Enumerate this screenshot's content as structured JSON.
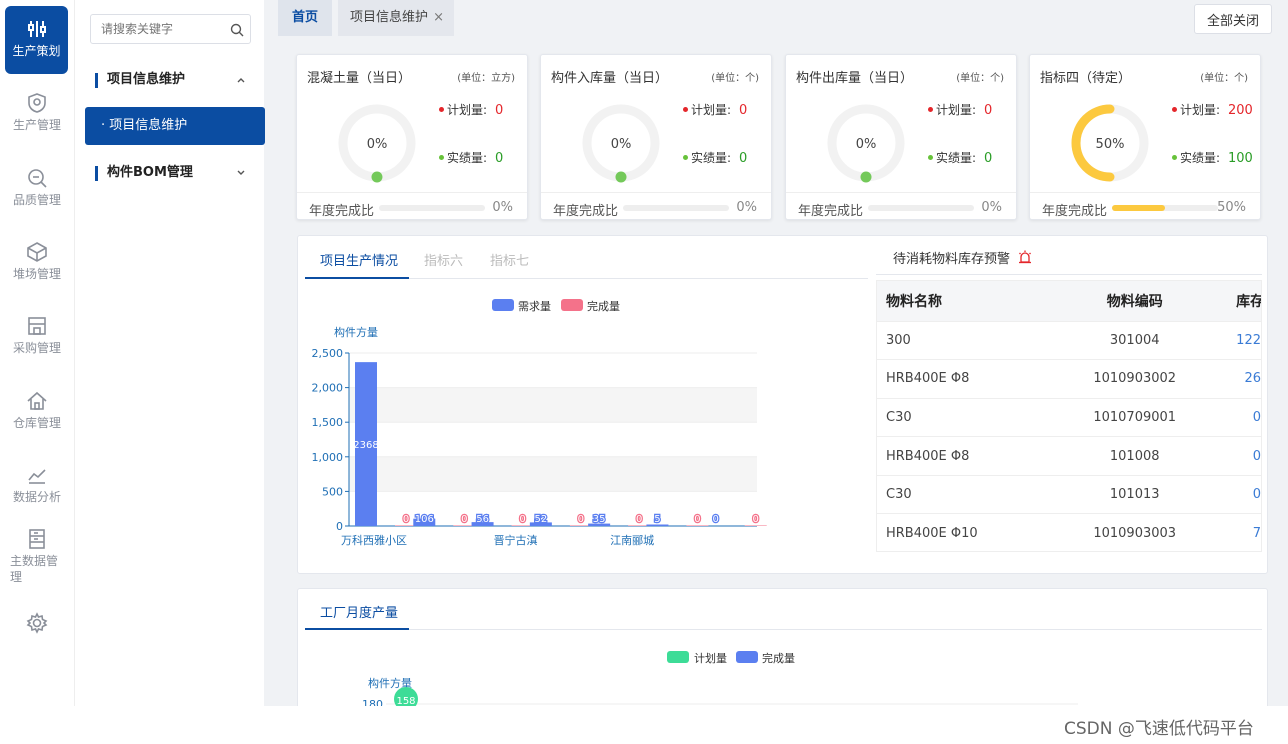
{
  "sidebar": {
    "items": [
      {
        "label": "生产策划",
        "icon": "sliders-icon"
      },
      {
        "label": "生产管理",
        "icon": "shield-icon"
      },
      {
        "label": "品质管理",
        "icon": "magnifier-icon"
      },
      {
        "label": "堆场管理",
        "icon": "cube-icon"
      },
      {
        "label": "采购管理",
        "icon": "store-icon"
      },
      {
        "label": "仓库管理",
        "icon": "house-icon"
      },
      {
        "label": "数据分析",
        "icon": "trend-icon"
      },
      {
        "label": "主数据管理",
        "icon": "server-icon"
      },
      {
        "label": "",
        "icon": "gear-icon"
      }
    ]
  },
  "menu": {
    "search_placeholder": "请搜索关键字",
    "group1": "项目信息维护",
    "sub1": "项目信息维护",
    "group2": "构件BOM管理"
  },
  "tabs": {
    "home": "首页",
    "current": "项目信息维护",
    "close": "×",
    "close_all": "全部关闭"
  },
  "cards": [
    {
      "title": "混凝土量（当日）",
      "unit": "(单位：立方)",
      "pct_label": "0%",
      "pct": 0,
      "plan_label": "计划量:",
      "plan": "0",
      "actual_label": "实绩量:",
      "actual": "0",
      "year_label": "年度完成比",
      "year_pct_label": "0%",
      "year_pct": 0
    },
    {
      "title": "构件入库量（当日）",
      "unit": "(单位：个)",
      "pct_label": "0%",
      "pct": 0,
      "plan_label": "计划量:",
      "plan": "0",
      "actual_label": "实绩量:",
      "actual": "0",
      "year_label": "年度完成比",
      "year_pct_label": "0%",
      "year_pct": 0
    },
    {
      "title": "构件出库量（当日）",
      "unit": "(单位：个)",
      "pct_label": "0%",
      "pct": 0,
      "plan_label": "计划量:",
      "plan": "0",
      "actual_label": "实绩量:",
      "actual": "0",
      "year_label": "年度完成比",
      "year_pct_label": "0%",
      "year_pct": 0
    },
    {
      "title": "指标四（待定）",
      "unit": "(单位：个)",
      "pct_label": "50%",
      "pct": 50,
      "plan_label": "计划量:",
      "plan": "200",
      "actual_label": "实绩量:",
      "actual": "100",
      "year_label": "年度完成比",
      "year_pct_label": "50%",
      "year_pct": 50
    }
  ],
  "colors": {
    "brand": "#0b4da2",
    "plan_dot": "#e4262b",
    "actual_dot": "#67c23a",
    "gauge": "#fcc93f",
    "demand": "#5b7ff0",
    "done": "#f4728a",
    "plan_green": "#3ddc97"
  },
  "production": {
    "tabs": [
      "项目生产情况",
      "指标六",
      "指标七"
    ],
    "warn_title": "待消耗物料库存预警",
    "warn_icon": "alarm-icon"
  },
  "chart_data": [
    {
      "type": "bar",
      "ylabel": "构件方量",
      "ylim": [
        0,
        2500
      ],
      "yticks": [
        "0",
        "500",
        "1,000",
        "1,500",
        "2,000",
        "2,500"
      ],
      "categories": [
        "万科西雅小区",
        "",
        "晋宁古滇",
        "",
        "江南郦城",
        "",
        ""
      ],
      "category_labels_shown": [
        "万科西雅小区",
        "晋宁古滇",
        "江南郦城"
      ],
      "legend_position": "top-center",
      "series": [
        {
          "name": "需求量",
          "values": [
            2368,
            106,
            56,
            52,
            35,
            5,
            0
          ]
        },
        {
          "name": "完成量",
          "values": [
            0,
            0,
            0,
            0,
            0,
            0,
            0
          ]
        }
      ]
    },
    {
      "type": "line",
      "title": "工厂月度产量",
      "ylabel": "构件方量",
      "legend_position": "top-center",
      "ytick_top": "180",
      "series": [
        {
          "name": "计划量",
          "values": [
            158
          ]
        },
        {
          "name": "完成量",
          "values": []
        }
      ]
    }
  ],
  "table": {
    "headers": [
      "物料名称",
      "物料编码",
      "库存"
    ],
    "rows": [
      [
        "300",
        "301004",
        "122"
      ],
      [
        "HRB400E Φ8",
        "1010903002",
        "26"
      ],
      [
        "C30",
        "1010709001",
        "0"
      ],
      [
        "HRB400E Φ8",
        "101008",
        "0"
      ],
      [
        "C30",
        "101013",
        "0"
      ],
      [
        "HRB400E Φ10",
        "1010903003",
        "7"
      ]
    ]
  },
  "watermark": "CSDN @飞速低代码平台"
}
